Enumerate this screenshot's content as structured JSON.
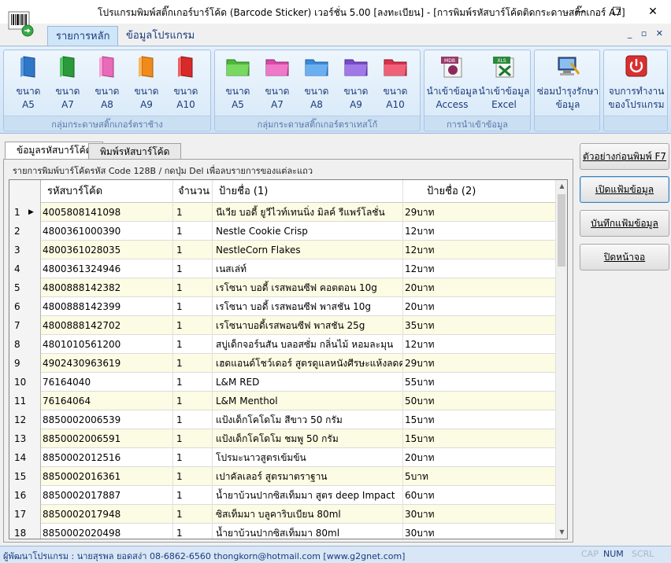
{
  "window": {
    "title": "โปรแกรมพิมพ์สติ๊กเกอร์บาร์โค้ด (Barcode Sticker) เวอร์ชั่น 5.00 [ลงทะเบียน] - [การพิมพ์รหัสบาร์โค้ดติดกระดาษสติ๊กเกอร์ A7]",
    "minimize": "—",
    "maximize": "☐",
    "close": "✕"
  },
  "ribbon_tabs": [
    {
      "label": "รายการหลัก"
    },
    {
      "label": "ข้อมูลโปรแกรม"
    }
  ],
  "mdi_controls": "_ ▫ ✕",
  "groups": [
    {
      "label": "กลุ่มกระดาษสติ๊กเกอร์ตราช้าง",
      "buttons": [
        {
          "label": "ขนาด\nA5",
          "icon": "folder-blue-icon",
          "color": "#2f78c8"
        },
        {
          "label": "ขนาด\nA7",
          "icon": "folder-green-icon",
          "color": "#2a9a3a"
        },
        {
          "label": "ขนาด\nA8",
          "icon": "folder-pink-icon",
          "color": "#e86ab8"
        },
        {
          "label": "ขนาด\nA9",
          "icon": "folder-orange-icon",
          "color": "#f08a1a"
        },
        {
          "label": "ขนาด\nA10",
          "icon": "folder-red-icon",
          "color": "#d82a2a"
        }
      ]
    },
    {
      "label": "กลุ่มกระดาษสติ๊กเกอร์ตราเทสโก้",
      "buttons": [
        {
          "label": "ขนาด\nA5",
          "icon": "folder-green-icon",
          "color": "#4cb83a"
        },
        {
          "label": "ขนาด\nA7",
          "icon": "folder-pink-icon",
          "color": "#d84aa8"
        },
        {
          "label": "ขนาด\nA8",
          "icon": "folder-blue-icon",
          "color": "#3a8ad8"
        },
        {
          "label": "ขนาด\nA9",
          "icon": "folder-purple-icon",
          "color": "#7a4ac8"
        },
        {
          "label": "ขนาด\nA10",
          "icon": "folder-red-icon",
          "color": "#d8324a"
        }
      ]
    },
    {
      "label": "การนำเข้าข้อมูล",
      "buttons": [
        {
          "label": "นำเข้าข้อมูล\nAccess",
          "icon": "mdb-icon",
          "badge": "MDB"
        },
        {
          "label": "นำเข้าข้อมูล\nExcel",
          "icon": "xls-icon",
          "badge": "XLS"
        }
      ]
    },
    {
      "label": "",
      "buttons": [
        {
          "label": "ซ่อมบำรุงรักษา\nข้อมูล",
          "icon": "computer-maintenance-icon"
        }
      ]
    },
    {
      "label": "",
      "buttons": [
        {
          "label": "จบการทำงาน\nของโปรแกรม",
          "icon": "power-icon"
        }
      ]
    }
  ],
  "content_tabs": [
    {
      "label": "ข้อมูลรหัสบาร์โค้ด"
    },
    {
      "label": "พิมพ์รหัสบาร์โค้ด"
    }
  ],
  "panel_caption": "รายการพิมพ์บาร์โค้ดรหัส Code 128B / กดปุ่ม Del เพื่อลบรายการของแต่ละแถว",
  "columns": [
    "รหัสบาร์โค้ด",
    "จำนวน",
    "ป้ายชื่อ (1)",
    "ป้ายชื่อ (2)"
  ],
  "row_pointer": "▶",
  "rows": [
    {
      "n": "1",
      "code": "4005808141098",
      "qty": "1",
      "name1": "นีเวีย บอดี้ ยูวีไวท์เทนนิ่ง  มิลค์ รีแพร์โลชั่น",
      "name2": "29บาท"
    },
    {
      "n": "2",
      "code": "4800361000390",
      "qty": "1",
      "name1": "Nestle Cookie Crisp",
      "name2": "12บาท"
    },
    {
      "n": "3",
      "code": "4800361028035",
      "qty": "1",
      "name1": "NestleCorn Flakes",
      "name2": "12บาท"
    },
    {
      "n": "4",
      "code": "4800361324946",
      "qty": "1",
      "name1": "เนสเล่ท์",
      "name2": "12บาท"
    },
    {
      "n": "5",
      "code": "4800888142382",
      "qty": "1",
      "name1": "เรโซนา บอดี้ เรสพอนซีฟ คอตตอน 10g",
      "name2": "20บาท"
    },
    {
      "n": "6",
      "code": "4800888142399",
      "qty": "1",
      "name1": "เรโซนา บอดี้ เรสพอนซีฟ พาสชัน  10g",
      "name2": "20บาท"
    },
    {
      "n": "7",
      "code": "4800888142702",
      "qty": "1",
      "name1": "เรโซนาบอดี้เรสพอนซีฟ พาสชัน  25g",
      "name2": "35บาท"
    },
    {
      "n": "8",
      "code": "4801010561200",
      "qty": "1",
      "name1": "สบู่เด็กจอร์นสัน บลอสซั่ม กลิ่นไม้  หอมละมุน",
      "name2": "12บาท"
    },
    {
      "n": "9",
      "code": "4902430963619",
      "qty": "1",
      "name1": "เฮดแอนด์โชว์เดอร์  สูตรดูแลหนังศีรษะแห้งลดค...",
      "name2": "29บาท"
    },
    {
      "n": "10",
      "code": "76164040",
      "qty": "1",
      "name1": "L&M RED",
      "name2": "55บาท"
    },
    {
      "n": "11",
      "code": "76164064",
      "qty": "1",
      "name1": "L&M Menthol",
      "name2": "50บาท"
    },
    {
      "n": "12",
      "code": "8850002006539",
      "qty": "1",
      "name1": "แป้งเด็กโคโดโม สีขาว 50 กรัม",
      "name2": "15บาท"
    },
    {
      "n": "13",
      "code": "8850002006591",
      "qty": "1",
      "name1": "แป้งเด็กโคโดโม  ชมพู 50 กรัม",
      "name2": "15บาท"
    },
    {
      "n": "14",
      "code": "8850002012516",
      "qty": "1",
      "name1": "โปรมะนาวสูตรเข้มข้น",
      "name2": "20บาท"
    },
    {
      "n": "15",
      "code": "8850002016361",
      "qty": "1",
      "name1": "เปาคัลเลอร์ สูตรมาตราฐาน",
      "name2": "5บาท"
    },
    {
      "n": "16",
      "code": "8850002017887",
      "qty": "1",
      "name1": "น้ำยาบ้วนปากซิสเท็มมา  สูตร deep Impact",
      "name2": "60บาท"
    },
    {
      "n": "17",
      "code": "8850002017948",
      "qty": "1",
      "name1": "ซิสเท็มมา บลูคาริบเบียน  80ml",
      "name2": "30บาท"
    },
    {
      "n": "18",
      "code": "8850002020498",
      "qty": "1",
      "name1": "น้ำยาบ้วนปากซิสเท็มมา  80ml",
      "name2": "30บาท"
    }
  ],
  "side_buttons": [
    {
      "label": "ตัวอย่างก่อนพิมพ์ F7"
    },
    {
      "label": "เปิดแฟ้มข้อมูล"
    },
    {
      "label": "บันทึกแฟ้มข้อมูล"
    },
    {
      "label": "ปิดหน้าจอ"
    }
  ],
  "status": {
    "text": "ผู้พัฒนาโปรแกรม : นายสุรพล ยอดสง่า 08-6862-6560 thongkorn@hotmail.com [www.g2gnet.com]",
    "cap": "CAP",
    "num": "NUM",
    "scrl": "SCRL"
  },
  "colors": {
    "accent": "#1a3a7a",
    "row_alt": "#fcfbe3",
    "ribbon": "#cde2f6"
  }
}
